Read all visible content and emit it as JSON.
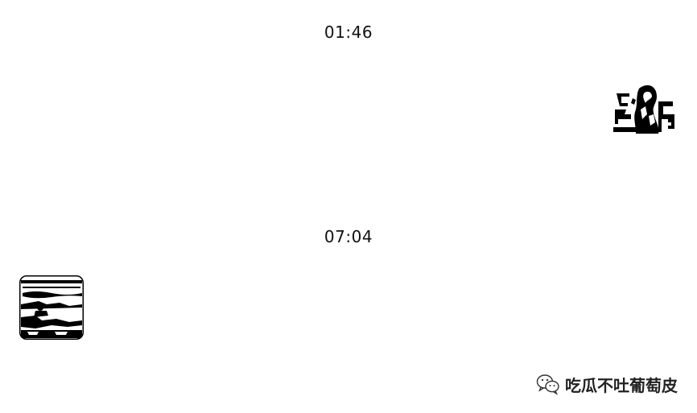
{
  "chat": {
    "messages": [
      {
        "timestamp": "01:46",
        "sender_side": "right"
      },
      {
        "timestamp": "07:04",
        "sender_side": "left"
      }
    ]
  },
  "watermark": {
    "icon": "wechat-icon",
    "text": "吃瓜不吐葡萄皮"
  },
  "colors": {
    "background": "#ffffff",
    "text": "#111111"
  }
}
